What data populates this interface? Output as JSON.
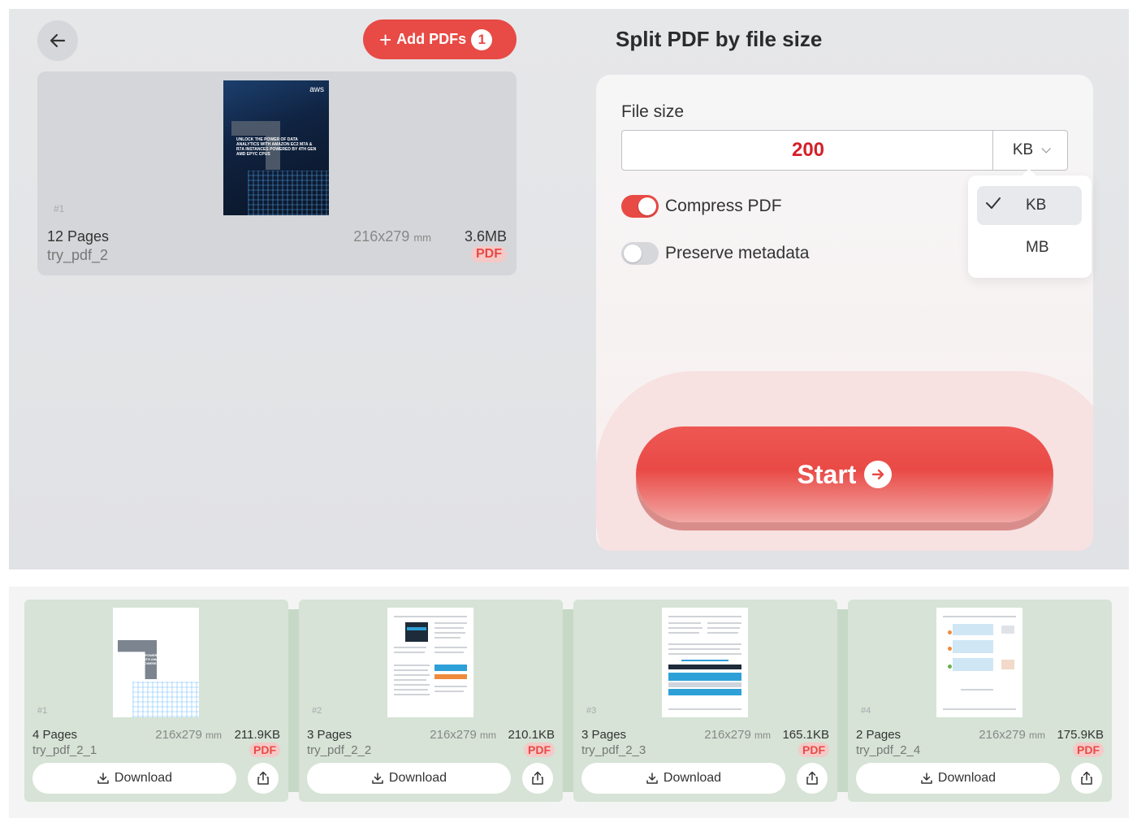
{
  "header": {
    "add_label": "Add PDFs",
    "add_count": "1",
    "title": "Split PDF by file size"
  },
  "source_file": {
    "index": "#1",
    "pages": "12 Pages",
    "name": "try_pdf_2",
    "dims": "216x279",
    "dims_unit": "mm",
    "size": "3.6MB",
    "type": "PDF",
    "cover_brand": "aws",
    "cover_headline": "UNLOCK THE POWER OF DATA ANALYTICS WITH AMAZON EC2 M7A & R7A INSTANCES POWERED BY 4TH GEN AMD EPYC CPUS"
  },
  "settings": {
    "file_size_label": "File size",
    "file_size_value": "200",
    "unit_selected": "KB",
    "unit_options": [
      "KB",
      "MB"
    ],
    "compress_label": "Compress PDF",
    "compress_on": true,
    "metadata_label": "Preserve metadata",
    "metadata_on": false,
    "start_label": "Start"
  },
  "results": [
    {
      "index": "#1",
      "pages": "4 Pages",
      "name": "try_pdf_2_1",
      "dims": "216x279",
      "dims_unit": "mm",
      "size": "211.9KB",
      "type": "PDF",
      "download_label": "Download",
      "thumb": "cover"
    },
    {
      "index": "#2",
      "pages": "3 Pages",
      "name": "try_pdf_2_2",
      "dims": "216x279",
      "dims_unit": "mm",
      "size": "210.1KB",
      "type": "PDF",
      "download_label": "Download",
      "thumb": "doc-a"
    },
    {
      "index": "#3",
      "pages": "3 Pages",
      "name": "try_pdf_2_3",
      "dims": "216x279",
      "dims_unit": "mm",
      "size": "165.1KB",
      "type": "PDF",
      "download_label": "Download",
      "thumb": "doc-b"
    },
    {
      "index": "#4",
      "pages": "2 Pages",
      "name": "try_pdf_2_4",
      "dims": "216x279",
      "dims_unit": "mm",
      "size": "175.9KB",
      "type": "PDF",
      "download_label": "Download",
      "thumb": "doc-c"
    }
  ],
  "colors": {
    "accent": "#e84a45",
    "value_red": "#d4202a",
    "result_card": "#d6e3d6"
  }
}
